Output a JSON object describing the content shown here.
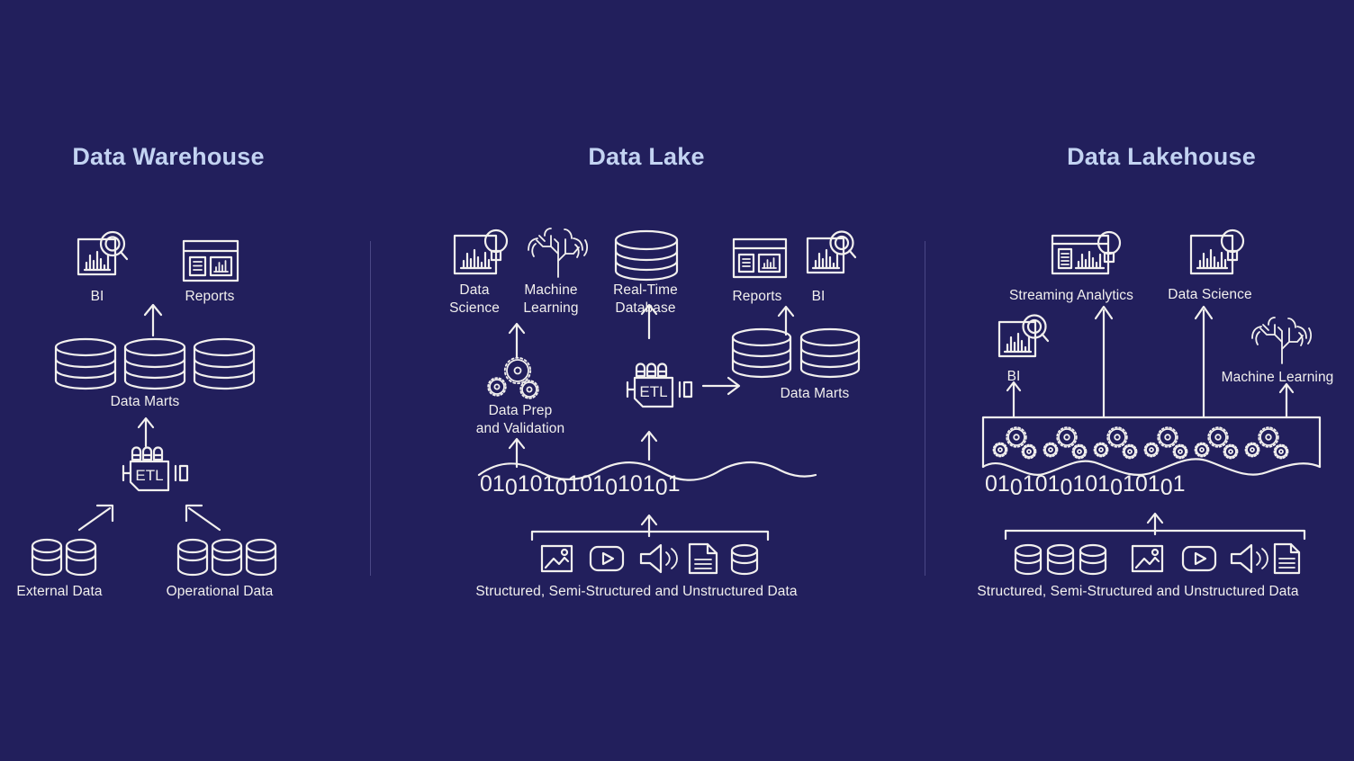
{
  "background_color": "#221f5c",
  "stroke_color": "#f2f0ee",
  "title_color": "#c3d3f2",
  "divider_color": "#4a4785",
  "columns": [
    {
      "id": "data-warehouse",
      "title": "Data Warehouse",
      "labels": {
        "bi": "BI",
        "reports": "Reports",
        "data_marts": "Data Marts",
        "etl": "ETL",
        "external_data": "External Data",
        "operational_data": "Operational Data"
      },
      "icons": [
        "bi-chart-target-icon",
        "reports-window-icon",
        "database-cylinder-icon",
        "etl-server-icon",
        "database-cylinder-icon"
      ],
      "database_counts": {
        "data_marts": 3,
        "external_data": 2,
        "operational_data": 3
      }
    },
    {
      "id": "data-lake",
      "title": "Data Lake",
      "labels": {
        "data_science": "Data\nScience",
        "machine_learning": "Machine\nLearning",
        "real_time_database": "Real-Time\nDatabase",
        "reports": "Reports",
        "bi": "BI",
        "data_prep": "Data Prep\nand Validation",
        "etl": "ETL",
        "data_marts": "Data Marts",
        "caption": "Structured, Semi-Structured and Unstructured Data"
      },
      "binary_text": "0101010101010101",
      "source_icons": [
        "image-icon",
        "video-icon",
        "audio-icon",
        "document-icon",
        "database-icon"
      ],
      "database_counts": {
        "data_marts": 2
      }
    },
    {
      "id": "data-lakehouse",
      "title": "Data Lakehouse",
      "labels": {
        "streaming_analytics": "Streaming Analytics",
        "data_science": "Data Science",
        "bi": "BI",
        "machine_learning": "Machine Learning",
        "caption": "Structured, Semi-Structured and Unstructured Data"
      },
      "binary_text": "0101010101010101",
      "gear_cluster_count": 6,
      "source_icons": [
        "database-icon",
        "database-icon",
        "database-icon",
        "image-icon",
        "video-icon",
        "audio-icon",
        "document-icon"
      ]
    }
  ]
}
